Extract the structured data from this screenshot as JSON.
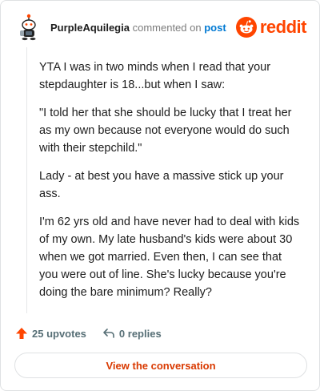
{
  "header": {
    "username": "PurpleAquilegia",
    "action_text": "commented on",
    "post_link": "post",
    "brand_name": "reddit",
    "brand_color": "#ff4500"
  },
  "comment": {
    "paragraphs": [
      "YTA I was in two minds when I read that your stepdaughter is 18...but when I saw:",
      "\"I told her that she should be lucky that I treat her as my own because not everyone would do such with their stepchild.\"",
      "Lady - at best you have a massive stick up your ass.",
      "I'm 62 yrs old and have never had to deal with kids of my own. My late husband's kids were about 30 when we got married. Even then, I can see that you were out of line. She's lucky because you're doing the bare minimum? Really?"
    ]
  },
  "actions": {
    "upvotes_label": "25 upvotes",
    "upvote_icon": "upvote-arrow-icon",
    "replies_label": "0 replies",
    "reply_icon": "reply-arrow-icon"
  },
  "cta": {
    "label": "View the conversation"
  }
}
